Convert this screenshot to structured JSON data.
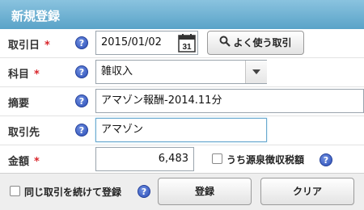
{
  "dialog": {
    "title": "新規登録"
  },
  "form": {
    "date": {
      "label": "取引日",
      "required_mark": "*",
      "value": "2015/01/02",
      "quick_button": "よく使う取引",
      "calendar_day": "31"
    },
    "account": {
      "label": "科目",
      "required_mark": "*",
      "value": "雑収入"
    },
    "memo": {
      "label": "摘要",
      "value": "アマゾン報酬-2014.11分"
    },
    "partner": {
      "label": "取引先",
      "value": "アマゾン"
    },
    "amount": {
      "label": "金額",
      "required_mark": "*",
      "value": "6,483",
      "withholding_label": "うち源泉徴収税額"
    }
  },
  "footer": {
    "continue_label": "同じ取引を続けて登録",
    "register_button": "登録",
    "clear_button": "クリア"
  },
  "help_glyph": "?",
  "colors": {
    "title_bar": "#6fb2d6",
    "required": "#d9262c",
    "help_icon": "#2c4fb8"
  }
}
